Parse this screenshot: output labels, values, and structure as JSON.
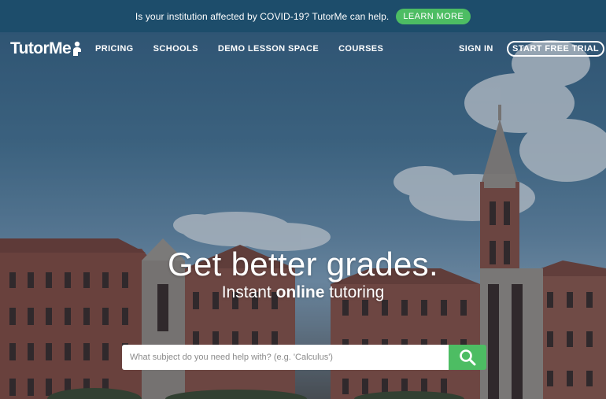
{
  "banner": {
    "text": "Is your institution affected by COVID-19? TutorMe can help.",
    "button_label": "LEARN MORE"
  },
  "nav": {
    "logo_text": "TutorMe",
    "links": [
      "PRICING",
      "SCHOOLS",
      "DEMO LESSON SPACE",
      "COURSES"
    ],
    "sign_in": "SIGN IN",
    "trial_button": "START FREE TRIAL"
  },
  "hero": {
    "headline": "Get better grades.",
    "sub_prefix": "Instant",
    "sub_bold": "online",
    "sub_suffix": "tutoring"
  },
  "search": {
    "placeholder": "What subject do you need help with? (e.g. 'Calculus')"
  },
  "colors": {
    "banner_bg": "#1d4d6b",
    "accent_green": "#4dbd63"
  }
}
